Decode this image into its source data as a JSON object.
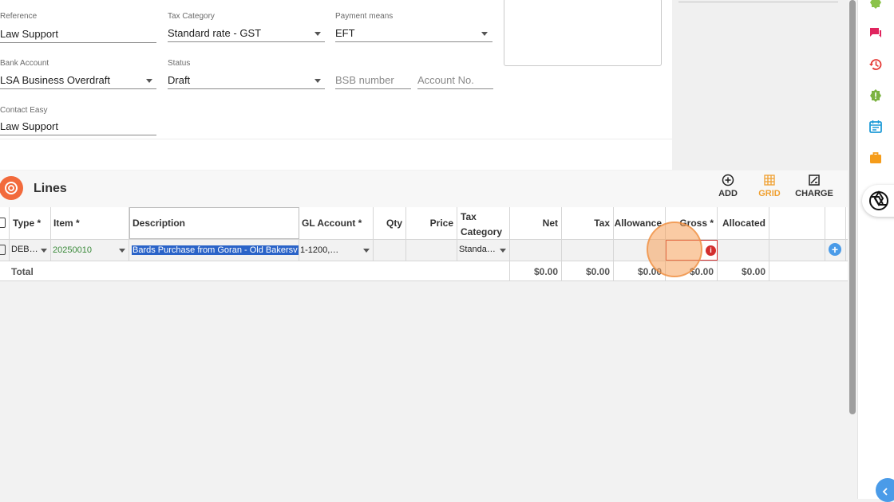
{
  "form": {
    "reference": {
      "label": "Reference",
      "value": "Law Support"
    },
    "tax_category": {
      "label": "Tax Category",
      "value": "Standard rate - GST"
    },
    "payment_means": {
      "label": "Payment means",
      "value": "EFT"
    },
    "bank_account": {
      "label": "Bank Account",
      "value": "LSA Business Overdraft"
    },
    "status": {
      "label": "Status",
      "value": "Draft"
    },
    "bsb_placeholder": "BSB number",
    "account_placeholder": "Account No.",
    "contact": {
      "label": "Contact Easy",
      "value": "Law Support"
    }
  },
  "lines": {
    "title": "Lines",
    "toolbar": {
      "add": "ADD",
      "grid": "GRID",
      "charge": "CHARGE"
    },
    "columns": [
      "Type *",
      "Item *",
      "Description",
      "GL Account *",
      "Qty",
      "Price",
      "Tax Category",
      "Net",
      "Tax",
      "Allowance",
      "Gross *",
      "Allocated"
    ],
    "row": {
      "type": "DEB…",
      "item": "20250010",
      "description": "Bards Purchase from Goran - Old Bakersv",
      "gl_account": "1-1200,…",
      "qty": "",
      "price": "",
      "tax_category": "Standa…",
      "net": "",
      "tax": "",
      "allowance": "",
      "gross": "",
      "allocated": ""
    },
    "totals": {
      "label": "Total",
      "net": "$0.00",
      "tax": "$0.00",
      "allowance": "$0.00",
      "gross": "$0.00",
      "allocated": "$0.00"
    }
  },
  "colors": {
    "accent": "#f26a3c",
    "grid_active": "#f0a030",
    "error": "#d32f2f",
    "add_row": "#4a9be8"
  }
}
